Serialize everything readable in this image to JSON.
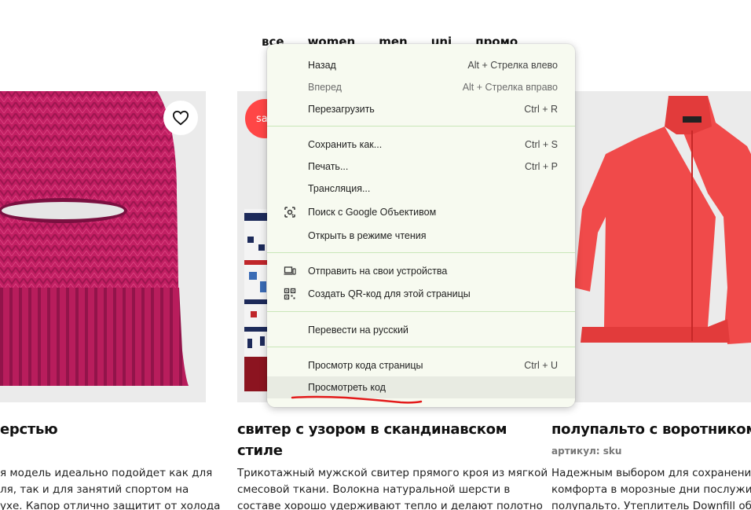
{
  "nav": {
    "items": [
      "все",
      "women",
      "men",
      "uni",
      "промо"
    ]
  },
  "products": [
    {
      "title": "ерстью",
      "desc": [
        "я модель идеально подойдет как для",
        "ля, так и для занятий спортом на",
        "ухе. Капор отлично защитит от холода"
      ]
    },
    {
      "badge": "sa",
      "title": [
        "свитер с узором в скандинавском",
        "стиле"
      ],
      "desc": [
        "Трикотажный мужской свитер прямого кроя из мягкой",
        "смесовой ткани. Волокна натуральной шерсти в",
        "составе хорошо удерживают тепло и делают полотно"
      ]
    },
    {
      "title": "полупальто с воротником с",
      "sku": "артикул: sku",
      "desc": [
        "Надежным выбором для сохранения те",
        "комфорта в морозные дни послужит ут",
        "полупальто. Утеплитель Downfill обладі"
      ]
    }
  ],
  "context_menu": {
    "items": [
      {
        "label": "Назад",
        "shortcut": "Alt + Стрелка влево"
      },
      {
        "label": "Вперед",
        "shortcut": "Alt + Стрелка вправо"
      },
      {
        "label": "Перезагрузить",
        "shortcut": "Ctrl + R"
      },
      {
        "label": "Сохранить как...",
        "shortcut": "Ctrl + S"
      },
      {
        "label": "Печать...",
        "shortcut": "Ctrl + P"
      },
      {
        "label": "Трансляция...",
        "shortcut": ""
      },
      {
        "label": "Поиск с Google Объективом",
        "shortcut": "",
        "icon": "google-lens-icon"
      },
      {
        "label": "Открыть в режиме чтения",
        "shortcut": ""
      },
      {
        "label": "Отправить на свои устройства",
        "shortcut": "",
        "icon": "devices-icon"
      },
      {
        "label": "Создать QR-код для этой страницы",
        "shortcut": "",
        "icon": "qr-code-icon"
      },
      {
        "label": "Перевести на русский",
        "shortcut": ""
      },
      {
        "label": "Просмотр кода страницы",
        "shortcut": "Ctrl + U"
      },
      {
        "label": "Просмотреть код",
        "shortcut": ""
      }
    ]
  },
  "colors": {
    "menu_bg": "#f7faf0",
    "separator": "#c9e6b8",
    "sale_badge": "#ff4646",
    "annotation_underline": "#e31b1b"
  }
}
